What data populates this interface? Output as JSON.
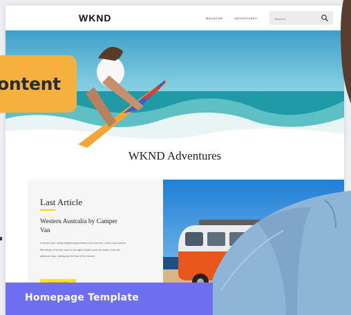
{
  "site": {
    "logo": "WKND",
    "nav": {
      "link1": "MAGAZINE",
      "link2": "ADVENTURES"
    },
    "search": {
      "placeholder": "SEARCH"
    }
  },
  "main": {
    "title": "WKND Adventures",
    "article": {
      "kicker": "Last Article",
      "title": "Western Australia by Camper Van",
      "body": "A vibrant road, slowly brightening stretches out to the sea, a line of sun seems like infinity, at the far reach of our sight it dulls to and all western from the afternoon haze, fading into the blue of the horizon.",
      "button": "READ MORE"
    }
  },
  "overlay": {
    "callout": "ontent",
    "banner": "Homepage Template"
  },
  "colors": {
    "callout": "#f5b03e",
    "banner": "#6e6ef0",
    "button": "#ffe600"
  }
}
